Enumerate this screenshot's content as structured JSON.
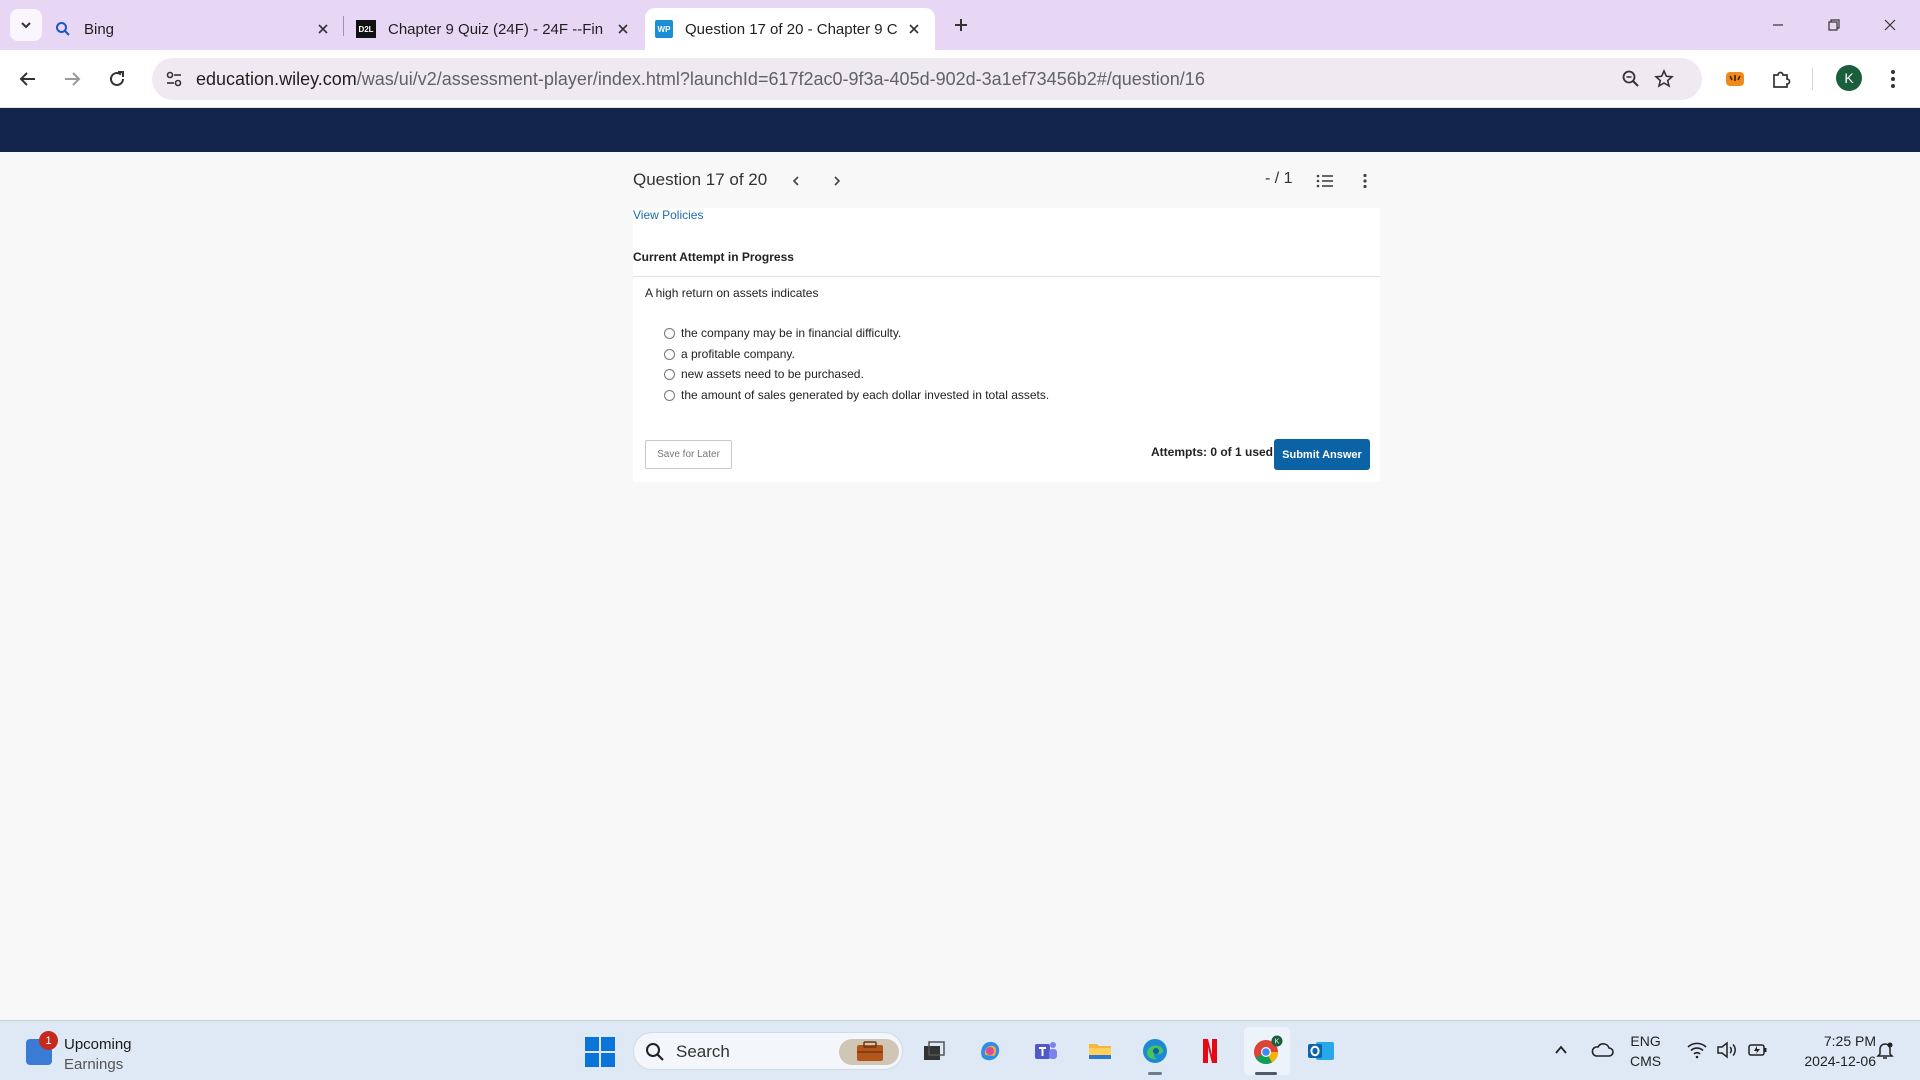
{
  "browser": {
    "tabs": [
      {
        "title": "Bing",
        "favicon": "search-icon",
        "active": false
      },
      {
        "title": "Chapter 9 Quiz (24F) - 24F --Fin",
        "favicon": "d2l-logo",
        "active": false
      },
      {
        "title": "Question 17 of 20 - Chapter 9 C",
        "favicon": "wileyplus-logo",
        "active": true
      }
    ],
    "favicon_labels": {
      "d2l": "D2L",
      "wp": "WP"
    },
    "url_host": "education.wiley.com",
    "url_path": "/was/ui/v2/assessment-player/index.html?launchId=617f2ac0-9f3a-405d-902d-3a1ef73456b2#/question/16",
    "profile_initial": "K"
  },
  "question": {
    "title": "Question 17 of 20",
    "score": "- / 1",
    "view_policies": "View Policies",
    "attempt_status": "Current Attempt in Progress",
    "prompt": "A high return on assets indicates",
    "choices": [
      "the company may be in financial difficulty.",
      "a profitable company.",
      "new assets need to be purchased.",
      "the amount of sales generated by each dollar invested in total assets."
    ],
    "save_label": "Save for Later",
    "attempts_label": "Attempts: 0 of 1 used",
    "submit_label": "Submit Answer"
  },
  "taskbar": {
    "widget_badge": "1",
    "widget_line1": "Upcoming",
    "widget_line2": "Earnings",
    "search_placeholder": "Search",
    "lang_line1": "ENG",
    "lang_line2": "CMS",
    "time": "7:25 PM",
    "date": "2024-12-06"
  },
  "colors": {
    "header_navy": "#13254a",
    "submit_blue": "#0b63a5",
    "link_blue": "#1b6eb3",
    "tabbar_purple": "#e8d7f4"
  }
}
